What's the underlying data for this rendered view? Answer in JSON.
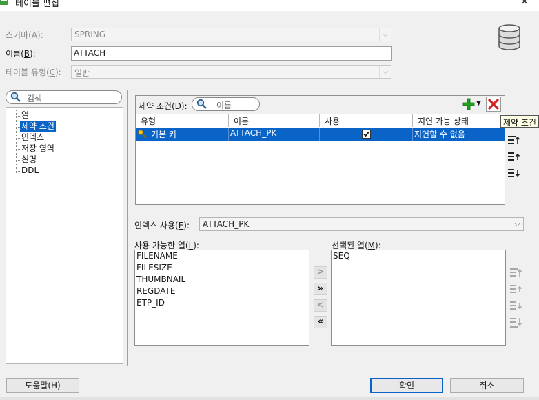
{
  "window": {
    "title": "테이블 편집",
    "close_glyph": "✕"
  },
  "form": {
    "schema_label_pre": "스키마(",
    "schema_label_key": "A",
    "schema_label_post": "):",
    "schema_value": "SPRING",
    "name_label_pre": "이름(",
    "name_label_key": "B",
    "name_label_post": "):",
    "name_value": "ATTACH",
    "tabletype_label_pre": "테이블 유형(",
    "tabletype_label_key": "C",
    "tabletype_label_post": "):",
    "tabletype_value": "일반"
  },
  "nav": {
    "search_placeholder": "검색",
    "items": [
      "열",
      "제약 조건",
      "인덱스",
      "저장 영역",
      "설명",
      "DDL"
    ],
    "selected_index": 1
  },
  "constraints": {
    "label_pre": "제약 조건(",
    "label_key": "D",
    "label_post": "):",
    "filter_placeholder": "이름",
    "columns": [
      "유형",
      "이름",
      "사용",
      "지연 가능 상태"
    ],
    "rows": [
      {
        "type": "기본 키",
        "name": "ATTACH_PK",
        "enabled": true,
        "deferrable": "지연할 수 없음"
      }
    ],
    "tooltip": "제약 조건"
  },
  "index": {
    "label_pre": "인덱스 사용(",
    "label_key": "E",
    "label_post": "):",
    "value": "ATTACH_PK"
  },
  "available_columns": {
    "label_pre": "사용 가능한 열(",
    "label_key": "L",
    "label_post": "):",
    "items": [
      "FILENAME",
      "FILESIZE",
      "THUMBNAIL",
      "REGDATE",
      "ETP_ID"
    ]
  },
  "selected_columns": {
    "label_pre": "선택된 열(",
    "label_key": "M",
    "label_post": "):",
    "items": [
      "SEQ"
    ]
  },
  "move_buttons": [
    ">",
    "»",
    "<",
    "«"
  ],
  "footer": {
    "help": "도움말(H)",
    "ok": "확인",
    "cancel": "취소"
  },
  "colors": {
    "selection": "#0a64c8",
    "add_icon": "#1fa31f",
    "delete_icon": "#d42020"
  },
  "icons": [
    "table-app-icon",
    "database-icon",
    "search-icon",
    "key-icon",
    "add-icon",
    "dropdown-arrow-icon",
    "delete-icon",
    "move-top-icon",
    "move-up-icon",
    "move-down-icon",
    "move-bottom-icon"
  ]
}
